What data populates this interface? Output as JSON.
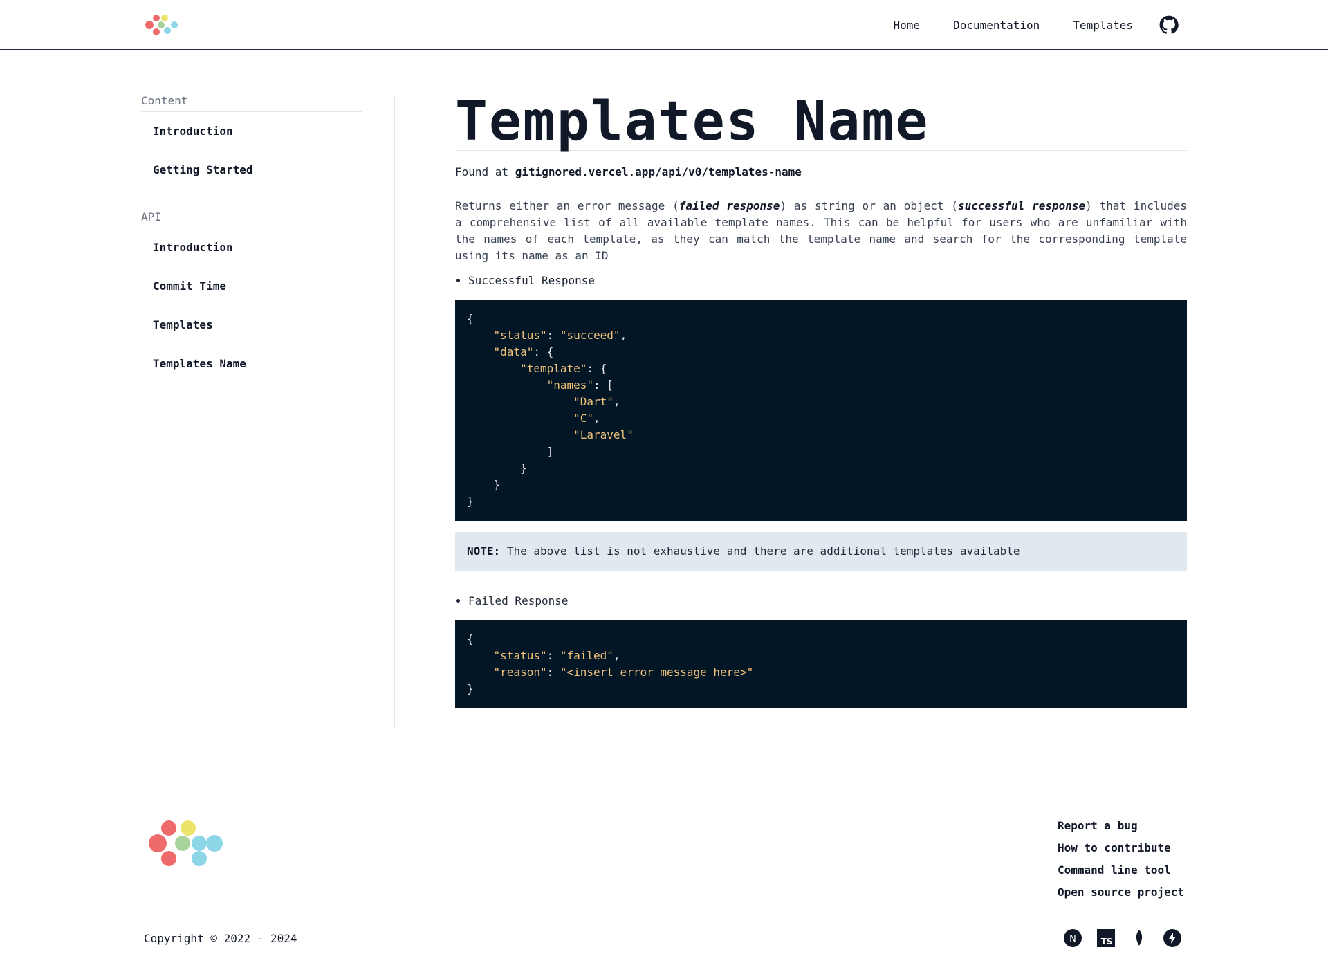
{
  "header": {
    "nav": [
      "Home",
      "Documentation",
      "Templates"
    ],
    "github_icon": "github-icon"
  },
  "sidebar": {
    "sections": [
      {
        "heading": "Content",
        "items": [
          "Introduction",
          "Getting Started"
        ]
      },
      {
        "heading": "API",
        "items": [
          "Introduction",
          "Commit Time",
          "Templates",
          "Templates Name"
        ]
      }
    ]
  },
  "main": {
    "title": "Templates Name",
    "found_prefix": "Found at",
    "found_url": "gitignored.vercel.app/api/v0/templates-name",
    "desc_1": "Returns either an error message (",
    "desc_failed": "failed response",
    "desc_2": ") as string or an object (",
    "desc_success": "successful response",
    "desc_3": ") that includes a comprehensive list of all available template names. This can be helpful for users who are unfamiliar with the names of each template, as they can match the template name and search for the corresponding template using its name as an ID",
    "success_label": "Successful Response",
    "success_code": {
      "status": "\"succeed\"",
      "names": [
        "\"Dart\"",
        "\"C\"",
        "\"Laravel\""
      ]
    },
    "note_label": "NOTE:",
    "note_text": "The above list is not exhaustive and there are additional templates available",
    "failed_label": "Failed Response",
    "failed_code": {
      "status": "\"failed\"",
      "reason": "\"<insert error message here>\""
    }
  },
  "footer": {
    "links": [
      "Report a bug",
      "How to contribute",
      "Command line tool",
      "Open source project"
    ],
    "copyright": "Copyright © 2022 - 2024",
    "tech_icons": [
      "nextjs-icon",
      "typescript-icon",
      "mongodb-icon",
      "thunder-icon"
    ]
  },
  "colors": {
    "code_bg": "#021626",
    "code_string": "#f3c27a",
    "note_bg": "#e2e8f0",
    "logo_red": "#ef6b6b",
    "logo_yellow": "#ece36a",
    "logo_green": "#a9d39c",
    "logo_blue": "#8dd6e8"
  }
}
